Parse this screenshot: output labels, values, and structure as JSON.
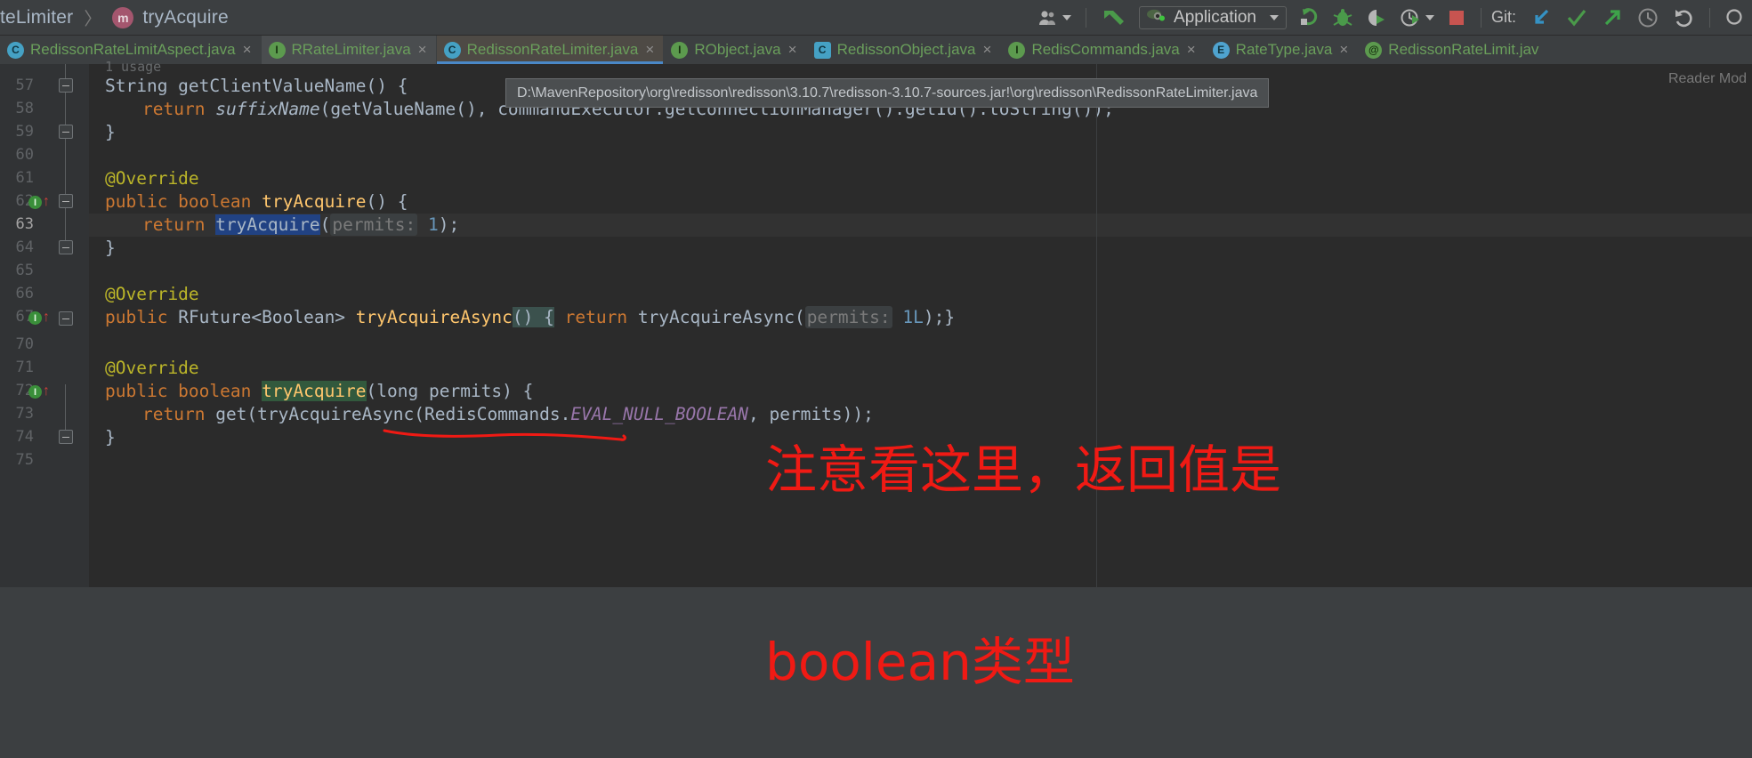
{
  "toolbar": {
    "breadcrumb_prefix": "teLimiter",
    "breadcrumb_sep": "〉",
    "method_badge": "m",
    "breadcrumb_method": "tryAcquire",
    "user_icon": "users-icon",
    "back_icon": "back-arrow-icon",
    "run_config_label": "Application",
    "run_config_icon": "application-run-icon",
    "rerun_icon": "rerun-icon",
    "debug_icon": "debug-icon",
    "run-coverage_icon": "run-with-coverage-icon",
    "profile_icon": "profiler-icon",
    "stop_icon": "stop-icon",
    "git_label": "Git:",
    "git_update_icon": "update-project-icon",
    "git_commit_icon": "commit-icon",
    "git_push_icon": "push-icon",
    "git_history_icon": "history-icon",
    "git_revert_icon": "revert-icon"
  },
  "tabs": [
    {
      "label": "RedissonRateLimitAspect.java",
      "icon": "class-file-icon",
      "icon_kind": "c",
      "close": "×",
      "state": "normal"
    },
    {
      "label": "RRateLimiter.java",
      "icon": "interface-file-icon",
      "icon_kind": "i",
      "close": "×",
      "state": "hover"
    },
    {
      "label": "RedissonRateLimiter.java",
      "icon": "class-file-icon",
      "icon_kind": "c",
      "close": "×",
      "state": "selected"
    },
    {
      "label": "RObject.java",
      "icon": "interface-file-icon",
      "icon_kind": "i",
      "close": "×",
      "state": "normal"
    },
    {
      "label": "RedissonObject.java",
      "icon": "abstract-class-file-icon",
      "icon_kind": "cb",
      "close": "×",
      "state": "normal"
    },
    {
      "label": "RedisCommands.java",
      "icon": "interface-file-icon",
      "icon_kind": "i",
      "close": "×",
      "state": "normal"
    },
    {
      "label": "RateType.java",
      "icon": "enum-file-icon",
      "icon_kind": "e",
      "close": "×",
      "state": "normal"
    },
    {
      "label": "RedissonRateLimit.jav",
      "icon": "annotation-file-icon",
      "icon_kind": "at",
      "close": "",
      "state": "normal"
    }
  ],
  "tooltip": {
    "text": "D:\\MavenRepository\\org\\redisson\\redisson\\3.10.7\\redisson-3.10.7-sources.jar!\\org\\redisson\\RedissonRateLimiter.java"
  },
  "editor": {
    "reader_mode": "Reader Mod",
    "usage_hint": "1 usage",
    "line_numbers": [
      "57",
      "58",
      "59",
      "60",
      "61",
      "62",
      "63",
      "64",
      "65",
      "66",
      "67",
      "70",
      "71",
      "72",
      "73",
      "74",
      "75"
    ],
    "lines": {
      "l57": "String getClientValueName() {",
      "l58_return": "return",
      "l58_suffix": "suffixName",
      "l58_rest": "(getValueName(), commandExecutor.getConnectionManager().getId().toString());",
      "l59": "}",
      "l61": "@Override",
      "l62_kw": "public boolean",
      "l62_mth": "tryAcquire",
      "l62_tail": "() {",
      "l63_kw": "return",
      "l63_sel": "tryAcquire",
      "l63_open": "(",
      "l63_hint": "permits:",
      "l63_num": "1",
      "l63_tail": ");",
      "l64": "}",
      "l66": "@Override",
      "l67_kw": "public",
      "l67_type": "RFuture<Boolean>",
      "l67_mth": "tryAcquireAsync",
      "l67_brace": "() {",
      "l67_kw2": "return",
      "l67_mth2": "tryAcquireAsync",
      "l67_open": "(",
      "l67_hint": "permits:",
      "l67_num": "1L",
      "l67_tail": ");}",
      "l71": "@Override",
      "l72_kw": "public boolean",
      "l72_mth": "tryAcquire",
      "l72_params": "(long permits) {",
      "l73_kw": "return",
      "l73_a": "get(tryAcquireAsync(RedisCommands.",
      "l73_const": "EVAL_NULL_BOOLEAN",
      "l73_b": ", permits));",
      "l74": "}"
    }
  },
  "annotations": {
    "red_text_line1": "注意看这里，返回值是",
    "red_text_line2": "boolean类型",
    "red_color": "#f01a14",
    "underline_shape": "hand-drawn-underline"
  }
}
